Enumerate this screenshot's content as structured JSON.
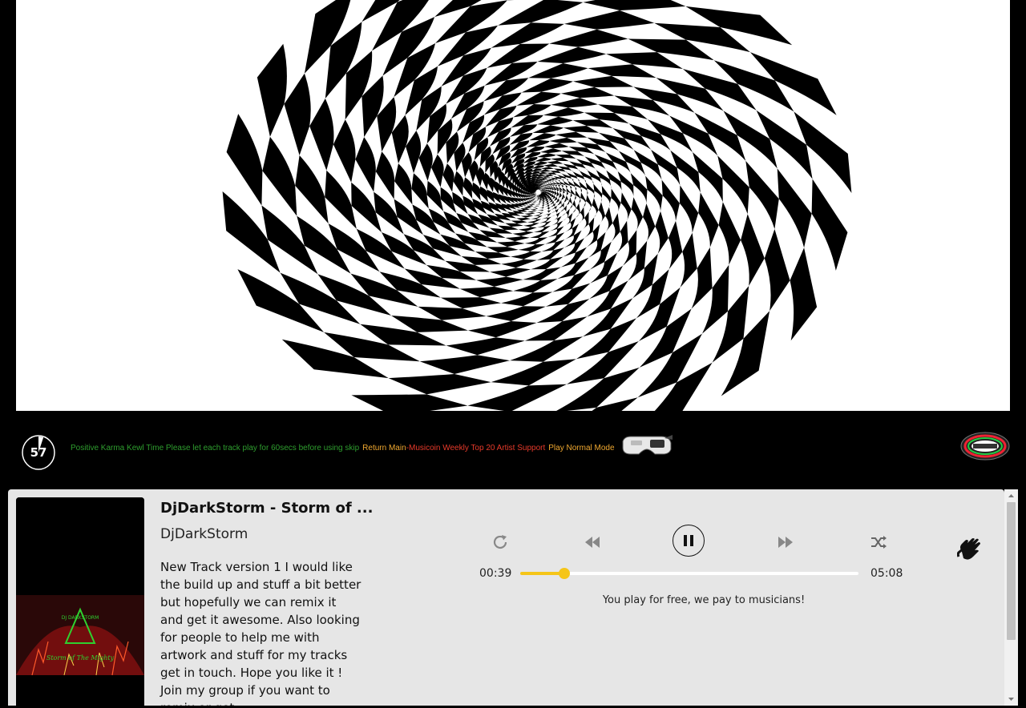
{
  "visual": {
    "prev_glyph": "‹",
    "next_glyph": "›"
  },
  "strip": {
    "countdown": "57",
    "countdown_progress": 0.05,
    "notice": "Positive Karma Kewl Time Please let each track play for 60secs before using skip",
    "return_main": "Return Main",
    "separator": "-",
    "weekly_top": "Musicoin Weekly Top 20 Artist Support",
    "play_normal": "Play Normal Mode",
    "icons": {
      "vr": "vr-headset-icon",
      "logo": "logo-badge"
    }
  },
  "player": {
    "title": "DjDarkStorm - Storm of ...",
    "artist": "DjDarkStorm",
    "description": "New Track version 1 I would like the build up and stuff a bit better but hopefully we can remix it and get it awesome. Also looking for people to help me with artwork and stuff for my tracks get in touch. Hope you like it ! Join my group if you want to remix or get",
    "cover_text_top": "DJ DARKSTORM",
    "cover_text_bottom": "Storm of The Mighty",
    "time_current": "00:39",
    "time_total": "05:08",
    "progress_fraction": 0.13,
    "tagline": "You play for free, we pay to musicians!",
    "accent_color": "#f5c518",
    "icons": {
      "repeat": "repeat-icon",
      "prev": "rewind-icon",
      "pause": "pause-icon",
      "next": "fast-forward-icon",
      "shuffle": "shuffle-icon",
      "sign": "sign-language-icon"
    }
  }
}
